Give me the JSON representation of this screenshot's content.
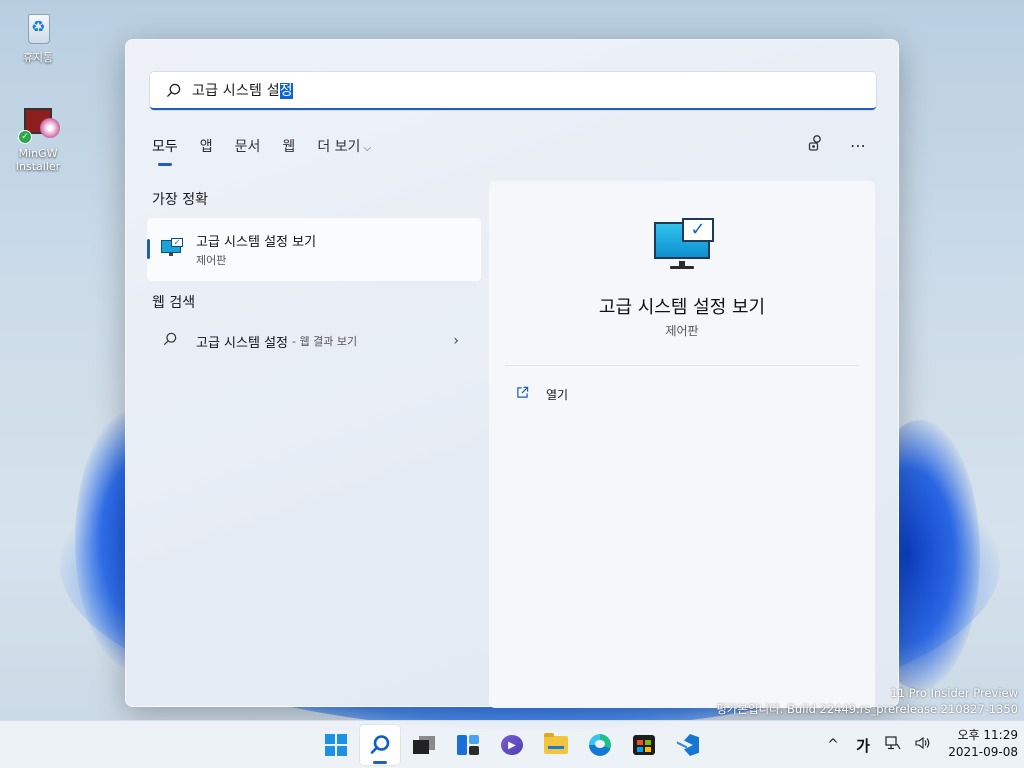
{
  "desktop": {
    "icons": [
      {
        "label": "휴지통",
        "icon": "recycle-bin-icon"
      },
      {
        "label": "MinGW Installer",
        "icon": "mingw-installer-icon"
      }
    ]
  },
  "search": {
    "query_prefix": "고급 시스템 설",
    "query_selected": "정",
    "tabs": [
      "모두",
      "앱",
      "문서",
      "웹",
      "더 보기"
    ],
    "active_tab": "모두"
  },
  "results": {
    "best_match_heading": "가장 정확",
    "best_match": {
      "title": "고급 시스템 설정 보기",
      "subtitle": "제어판"
    },
    "web_heading": "웹 검색",
    "web_query": "고급 시스템 설정",
    "web_suffix": "- 웹 결과 보기"
  },
  "detail": {
    "title": "고급 시스템 설정 보기",
    "subtitle": "제어판",
    "action_open": "열기"
  },
  "watermark": {
    "line1": "11 Pro Insider Preview",
    "line2": "평가본입니다. Build 22449.rs_prerelease.210827-1350"
  },
  "taskbar": {
    "apps": [
      "start-icon",
      "search-icon",
      "task-view-icon",
      "widgets-icon",
      "chat-icon",
      "file-explorer-icon",
      "edge-icon",
      "store-icon",
      "vscode-icon"
    ],
    "tray_chevron": "^",
    "ime": "가",
    "time": "오후 11:29",
    "date": "2021-09-08"
  },
  "colors": {
    "accent": "#1f5fb8",
    "selection": "#0a64d3"
  }
}
